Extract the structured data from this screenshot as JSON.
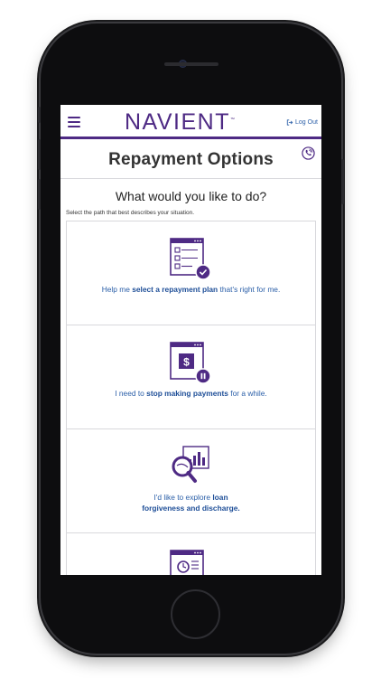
{
  "header": {
    "logo": "NAVIENT",
    "logo_tm": "™",
    "logout_label": "Log Out"
  },
  "page": {
    "title": "Repayment Options",
    "question": "What would you like to do?",
    "subtext": "Select the path that best describes your situation."
  },
  "options": [
    {
      "icon": "checklist-icon",
      "prefix": "Help me ",
      "bold": "select a repayment plan",
      "suffix": " that's right for me."
    },
    {
      "icon": "pause-payment-icon",
      "prefix": "I need to ",
      "bold": "stop making payments",
      "suffix": " for a while."
    },
    {
      "icon": "magnify-chart-icon",
      "prefix": "I'd like to explore ",
      "bold": "loan",
      "line2_bold": "forgiveness and discharge."
    }
  ],
  "colors": {
    "brand_purple": "#4e2a84",
    "link_blue": "#2b5fa8"
  }
}
